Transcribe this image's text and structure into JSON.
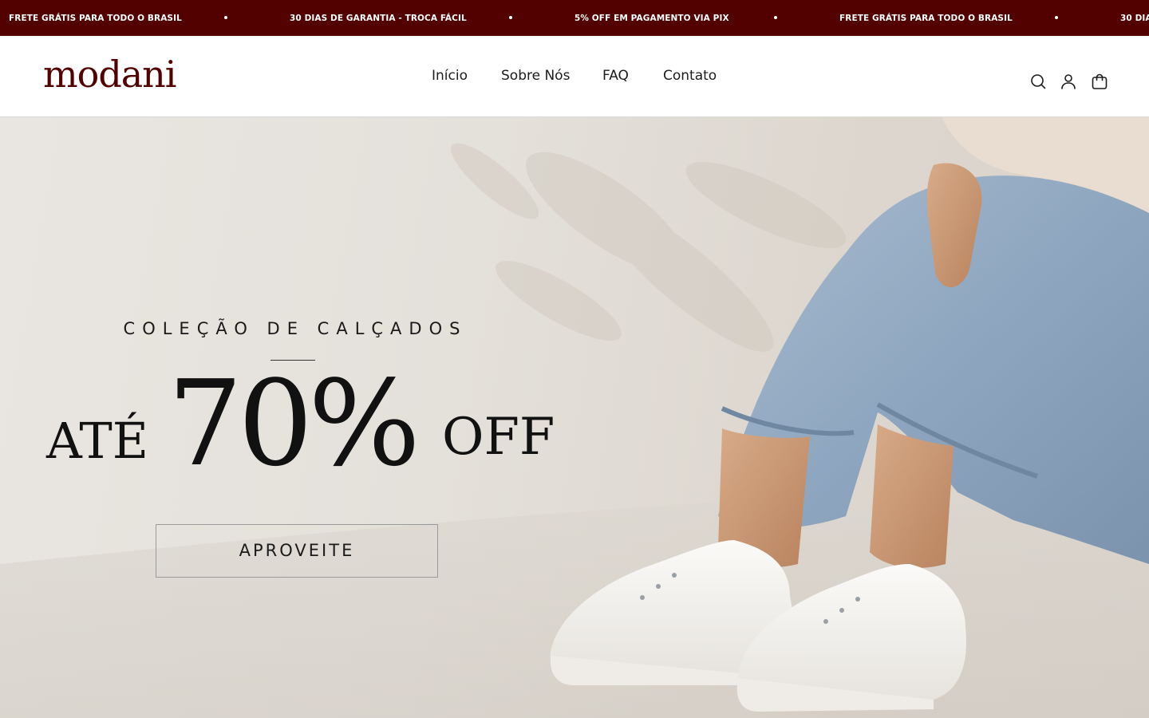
{
  "announcement": {
    "messages": [
      "FRETE GRÁTIS PARA TODO O BRASIL",
      "30 DIAS DE GARANTIA - TROCA FÁCIL",
      "5% OFF EM PAGAMENTO VIA PIX",
      "FRETE GRÁTIS PARA TODO O BRASIL",
      "30 DIAS"
    ],
    "background": "#520000"
  },
  "header": {
    "logo": "modani",
    "nav": [
      "Início",
      "Sobre Nós",
      "FAQ",
      "Contato"
    ],
    "icons": [
      "search-icon",
      "account-icon",
      "cart-icon"
    ]
  },
  "hero": {
    "kicker": "COLEÇÃO DE CALÇADOS",
    "prefix": "ATÉ",
    "discount": "70%",
    "suffix": "OFF",
    "cta": "APROVEITE"
  },
  "colors": {
    "brand": "#520000",
    "text": "#1c1c1c"
  }
}
